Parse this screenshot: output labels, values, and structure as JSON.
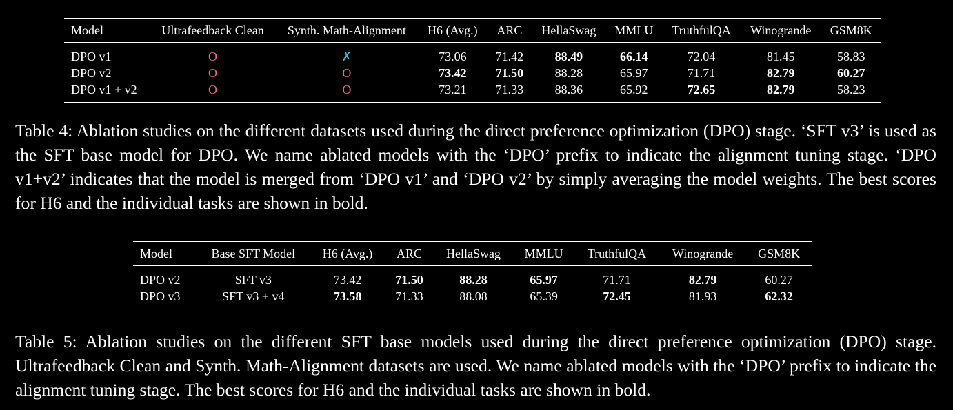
{
  "table4": {
    "headers": [
      "Model",
      "Ultrafeedback Clean",
      "Synth. Math-Alignment",
      "H6 (Avg.)",
      "ARC",
      "HellaSwag",
      "MMLU",
      "TruthfulQA",
      "Winogrande",
      "GSM8K"
    ],
    "rows": [
      {
        "model": "DPO v1",
        "uf": "O",
        "sm": "✗",
        "h6": "73.06",
        "arc": "71.42",
        "hella": "88.49",
        "mmlu": "66.14",
        "tqa": "72.04",
        "wino": "81.45",
        "gsm": "58.83"
      },
      {
        "model": "DPO v2",
        "uf": "O",
        "sm": "O",
        "h6": "73.42",
        "arc": "71.50",
        "hella": "88.28",
        "mmlu": "65.97",
        "tqa": "71.71",
        "wino": "82.79",
        "gsm": "60.27"
      },
      {
        "model": "DPO v1 + v2",
        "uf": "O",
        "sm": "O",
        "h6": "73.21",
        "arc": "71.33",
        "hella": "88.36",
        "mmlu": "65.92",
        "tqa": "72.65",
        "wino": "82.79",
        "gsm": "58.23"
      }
    ]
  },
  "caption4": "Table 4: Ablation studies on the different datasets used during the direct preference optimization (DPO) stage. ‘SFT v3’ is used as the SFT base model for DPO. We name ablated models with the ‘DPO’ prefix to indicate the alignment tuning stage. ‘DPO v1+v2’ indicates that the model is merged from ‘DPO v1’ and ‘DPO v2’ by simply averaging the model weights. The best scores for H6 and the individual tasks are shown in bold.",
  "table5": {
    "headers": [
      "Model",
      "Base SFT Model",
      "H6 (Avg.)",
      "ARC",
      "HellaSwag",
      "MMLU",
      "TruthfulQA",
      "Winogrande",
      "GSM8K"
    ],
    "rows": [
      {
        "model": "DPO v2",
        "base": "SFT v3",
        "h6": "73.42",
        "arc": "71.50",
        "hella": "88.28",
        "mmlu": "65.97",
        "tqa": "71.71",
        "wino": "82.79",
        "gsm": "60.27"
      },
      {
        "model": "DPO v3",
        "base": "SFT v3 + v4",
        "h6": "73.58",
        "arc": "71.33",
        "hella": "88.08",
        "mmlu": "65.39",
        "tqa": "72.45",
        "wino": "81.93",
        "gsm": "62.32"
      }
    ]
  },
  "caption5": "Table 5: Ablation studies on the different SFT base models used during the direct preference optimization (DPO) stage. Ultrafeedback Clean and Synth. Math-Alignment datasets are used. We name ablated models with the ‘DPO’ prefix to indicate the alignment tuning stage. The best scores for H6 and the individual tasks are shown in bold.",
  "colors": {
    "o_mark": "#f06292",
    "x_mark": "#26c6da",
    "background": "#000000",
    "text": "#ffffff"
  }
}
